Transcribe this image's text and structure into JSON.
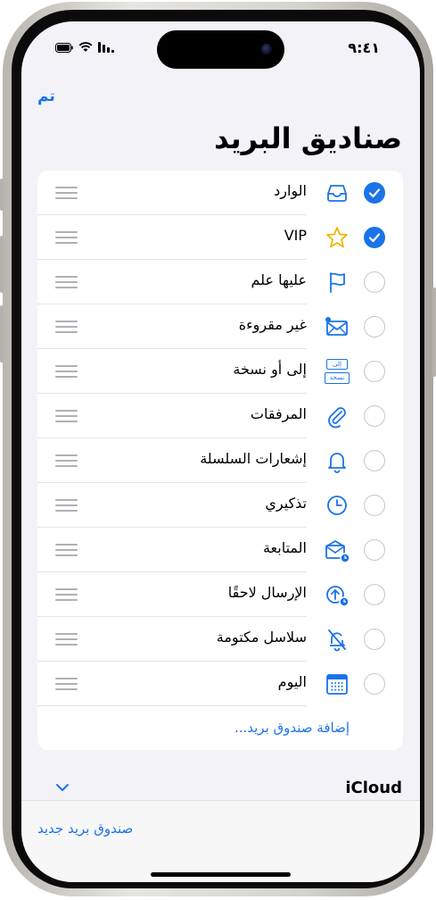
{
  "status": {
    "time": "٩:٤١"
  },
  "nav": {
    "done": "تم",
    "title": "صناديق البريد"
  },
  "mailboxes": [
    {
      "label": "الوارد",
      "icon": "inbox-tray-icon",
      "checked": true
    },
    {
      "label": "VIP",
      "icon": "star-icon",
      "checked": true
    },
    {
      "label": "عليها علم",
      "icon": "flag-icon",
      "checked": false
    },
    {
      "label": "غير مقروءة",
      "icon": "unread-envelope-icon",
      "checked": false
    },
    {
      "label": "إلى أو نسخة",
      "icon": "to-cc-icon",
      "checked": false,
      "icon_text": [
        "إلى",
        "نسخة"
      ]
    },
    {
      "label": "المرفقات",
      "icon": "paperclip-icon",
      "checked": false
    },
    {
      "label": "إشعارات السلسلة",
      "icon": "bell-icon",
      "checked": false
    },
    {
      "label": "تذكيري",
      "icon": "clock-icon",
      "checked": false
    },
    {
      "label": "المتابعة",
      "icon": "follow-up-envelope-icon",
      "checked": false
    },
    {
      "label": "الإرسال لاحقًا",
      "icon": "send-later-icon",
      "checked": false
    },
    {
      "label": "سلاسل مكتومة",
      "icon": "muted-bell-icon",
      "checked": false
    },
    {
      "label": "اليوم",
      "icon": "calendar-icon",
      "checked": false
    }
  ],
  "add_mailbox": "إضافة صندوق بريد...",
  "section": {
    "account": "iCloud"
  },
  "toolbar": {
    "new_mailbox": "صندوق بريد جديد"
  },
  "colors": {
    "accent": "#1a73e8",
    "background": "#f2f2f7"
  }
}
